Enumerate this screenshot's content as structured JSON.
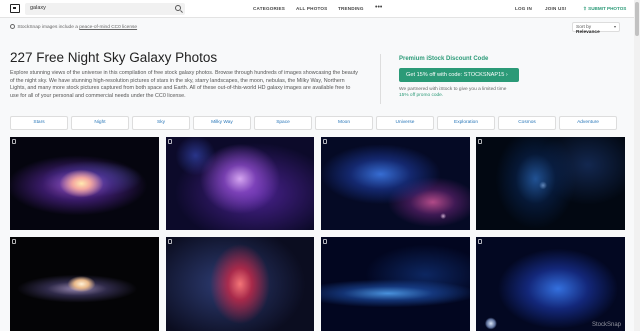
{
  "header": {
    "search_value": "galaxy",
    "nav": [
      "CATEGORIES",
      "ALL PHOTOS",
      "TRENDING"
    ],
    "more_label": "•••",
    "login": "LOG IN",
    "join": "JOIN US!",
    "submit": "SUBMIT PHOTOS"
  },
  "license": {
    "prefix": "StockSnap images include a",
    "link": "peace-of-mind CC0 license"
  },
  "sort": {
    "label": "Sort by",
    "value": "Relevance"
  },
  "page": {
    "title": "227 Free Night Sky Galaxy Photos",
    "description": "Explore stunning views of the universe in this compilation of free stock galaxy photos. Browse through hundreds of images showcasing the beauty of the night sky. We have stunning high-resolution pictures of stars in the sky, starry landscapes, the moon, nebulas, the Milky Way, Northern Lights, and many more stock pictures captured from both space and Earth. All of these out-of-this-world HD galaxy images are available free to use for all of your personal and commercial needs under the CC0 license."
  },
  "promo": {
    "title": "Premium iStock Discount Code",
    "button": "Get 15% off with code: STOCKSNAP15 ›",
    "note_prefix": "We partnered with iStock to give you a limited time",
    "note_link": "15% off promo code."
  },
  "tags": [
    "Stars",
    "Night",
    "Sky",
    "Milky Way",
    "Space",
    "Moon",
    "Universe",
    "Exploration",
    "Cosmos",
    "Adventure"
  ],
  "watermark": "StockSnap"
}
